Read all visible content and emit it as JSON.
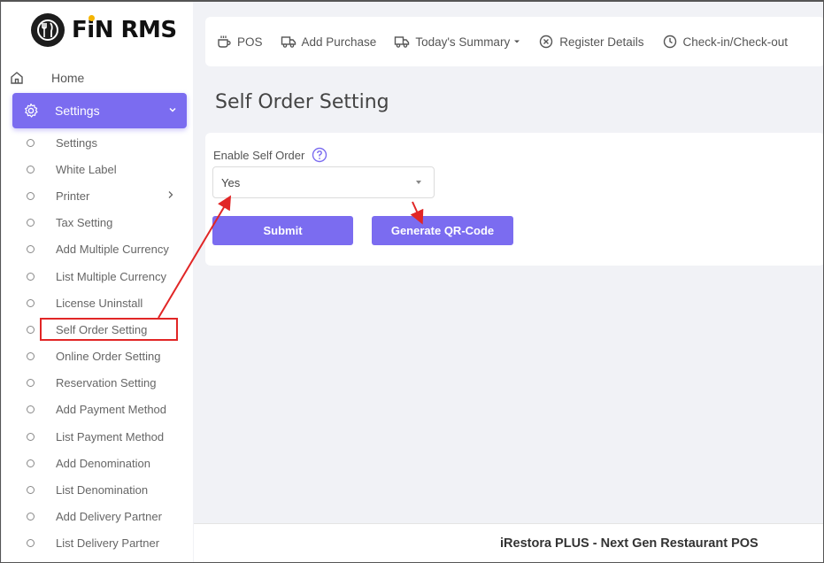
{
  "brand": {
    "logo_text_prefix": "F",
    "logo_text_i": "i",
    "logo_text_suffix": "N RMS"
  },
  "sidebar": {
    "home_label": "Home",
    "settings_label": "Settings",
    "sub_items": [
      {
        "label": "Settings",
        "has_arrow": false
      },
      {
        "label": "White Label",
        "has_arrow": false
      },
      {
        "label": "Printer",
        "has_arrow": true
      },
      {
        "label": "Tax Setting",
        "has_arrow": false
      },
      {
        "label": "Add Multiple Currency",
        "has_arrow": false
      },
      {
        "label": "List Multiple Currency",
        "has_arrow": false
      },
      {
        "label": "License Uninstall",
        "has_arrow": false
      },
      {
        "label": "Self Order Setting",
        "has_arrow": false
      },
      {
        "label": "Online Order Setting",
        "has_arrow": false
      },
      {
        "label": "Reservation Setting",
        "has_arrow": false
      },
      {
        "label": "Add Payment Method",
        "has_arrow": false
      },
      {
        "label": "List Payment Method",
        "has_arrow": false
      },
      {
        "label": "Add Denomination",
        "has_arrow": false
      },
      {
        "label": "List Denomination",
        "has_arrow": false
      },
      {
        "label": "Add Delivery Partner",
        "has_arrow": false
      },
      {
        "label": "List Delivery Partner",
        "has_arrow": false
      }
    ]
  },
  "topbar": {
    "pos_label": "POS",
    "add_purchase_label": "Add Purchase",
    "todays_summary_label": "Today's Summary",
    "register_details_label": "Register Details",
    "checkin_label": "Check-in/Check-out"
  },
  "page": {
    "title": "Self Order Setting",
    "enable_label": "Enable Self Order",
    "select_value": "Yes",
    "submit_label": "Submit",
    "generate_qr_label": "Generate QR-Code"
  },
  "footer": {
    "text": "iRestora PLUS - Next Gen Restaurant POS"
  },
  "colors": {
    "accent": "#7b6cf0",
    "annotation_red": "#e12626"
  }
}
